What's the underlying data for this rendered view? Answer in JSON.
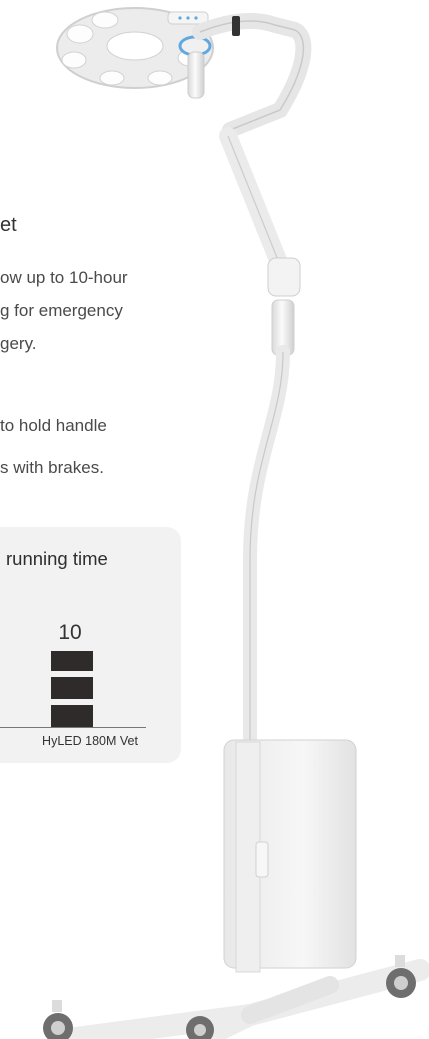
{
  "product": {
    "title_fragment": "et",
    "paragraph1_lines": [
      "ow up to 10-hour",
      "g for emergency",
      "gery."
    ],
    "paragraph2_lines": [
      "to hold handle",
      "s with brakes."
    ]
  },
  "card": {
    "title": "running time",
    "chart_data": {
      "type": "bar",
      "categories": [
        "HyLED 180M Vet"
      ],
      "values": [
        10
      ],
      "title": "running time",
      "xlabel": "",
      "ylabel": ""
    }
  },
  "colors": {
    "bar": "#2f2b2a",
    "card_bg": "#f2f2f2",
    "accent_ring": "#5fa8e0"
  }
}
